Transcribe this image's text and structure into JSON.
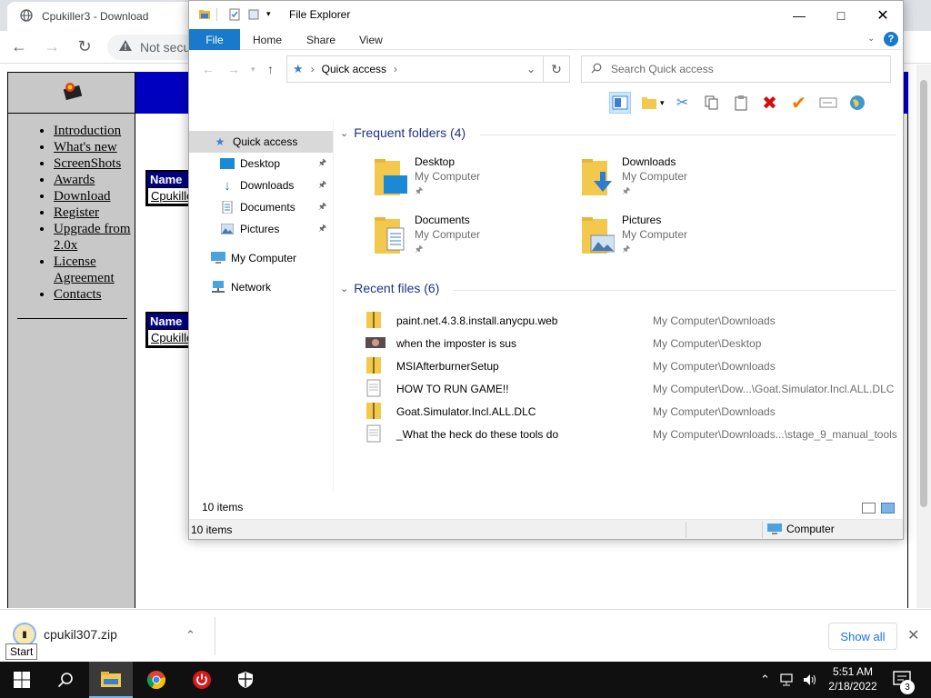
{
  "browser": {
    "tab_title": "Cpukiller3 - Download",
    "omnibox_text": "Not secure"
  },
  "website": {
    "nav_links": [
      "Introduction",
      "What's new",
      "ScreenShots",
      "Awards",
      "Download",
      "Register",
      "Upgrade from 2.0x",
      "License Agreement",
      "Contacts"
    ],
    "table1": {
      "header": "Name",
      "cell": "Cpukiller"
    },
    "table2": {
      "header": "Name",
      "cell": "Cpukiller"
    }
  },
  "download_bar": {
    "file_name": "cpukil307.zip",
    "show_all": "Show all"
  },
  "tooltip": "Start",
  "explorer": {
    "title": "File Explorer",
    "ribbon_tabs": {
      "file": "File",
      "home": "Home",
      "share": "Share",
      "view": "View"
    },
    "address": "Quick access",
    "search_placeholder": "Search Quick access",
    "nav": {
      "quick_access": "Quick access",
      "desktop": "Desktop",
      "downloads": "Downloads",
      "documents": "Documents",
      "pictures": "Pictures",
      "my_computer": "My Computer",
      "network": "Network"
    },
    "frequent_header": "Frequent folders (4)",
    "folders": [
      {
        "name": "Desktop",
        "location": "My Computer"
      },
      {
        "name": "Downloads",
        "location": "My Computer"
      },
      {
        "name": "Documents",
        "location": "My Computer"
      },
      {
        "name": "Pictures",
        "location": "My Computer"
      }
    ],
    "recent_header": "Recent files (6)",
    "recent_files": [
      {
        "name": "paint.net.4.3.8.install.anycpu.web",
        "path": "My Computer\\Downloads",
        "icon": "zip"
      },
      {
        "name": "when the imposter is sus",
        "path": "My Computer\\Desktop",
        "icon": "image"
      },
      {
        "name": "MSIAfterburnerSetup",
        "path": "My Computer\\Downloads",
        "icon": "zip"
      },
      {
        "name": "HOW TO RUN GAME!!",
        "path": "My Computer\\Dow...\\Goat.Simulator.Incl.ALL.DLC",
        "icon": "text"
      },
      {
        "name": "Goat.Simulator.Incl.ALL.DLC",
        "path": "My Computer\\Downloads",
        "icon": "zip"
      },
      {
        "name": "_What the heck do these tools do",
        "path": "My Computer\\Downloads...\\stage_9_manual_tools",
        "icon": "text"
      }
    ],
    "item_count": "10 items",
    "status_left": "10 items",
    "status_right": "Computer"
  },
  "taskbar": {
    "clock_time": "5:51 AM",
    "clock_date": "2/18/2022",
    "notification_count": "3"
  }
}
